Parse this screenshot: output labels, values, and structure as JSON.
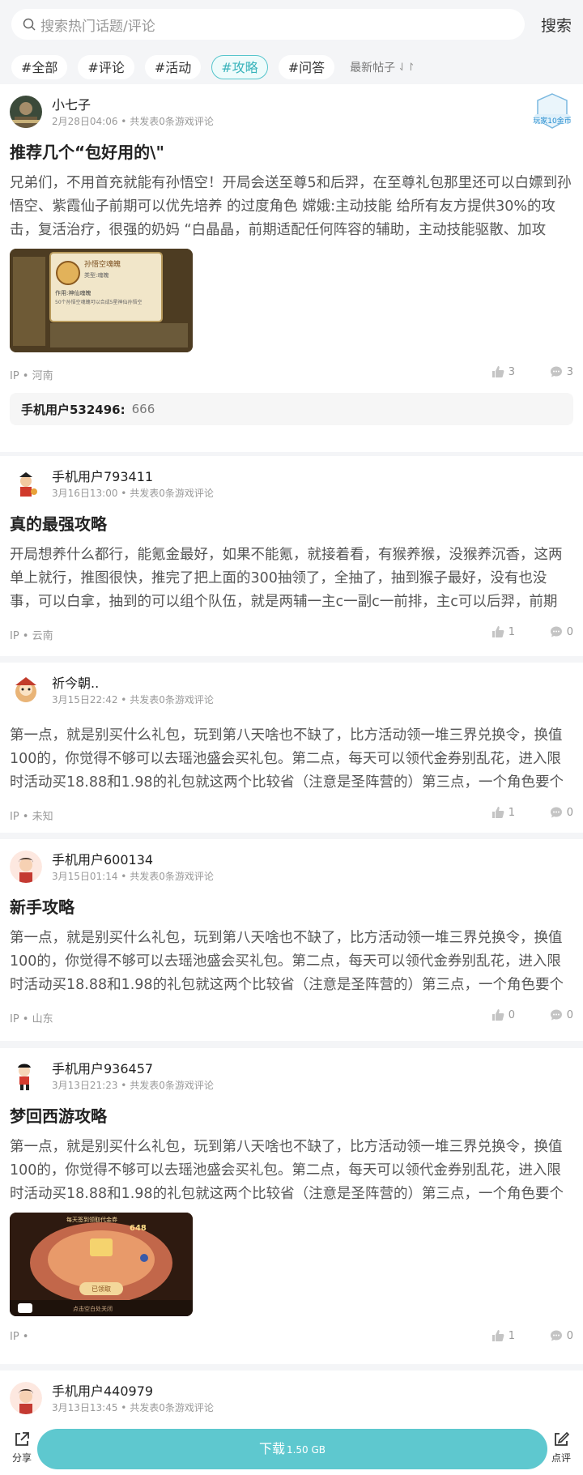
{
  "search": {
    "placeholder": "搜索热门话题/评论",
    "button": "搜索"
  },
  "tabs": [
    {
      "label": "#全部"
    },
    {
      "label": "#评论"
    },
    {
      "label": "#活动"
    },
    {
      "label": "#攻略"
    },
    {
      "label": "#问答"
    }
  ],
  "active_tab": "#攻略",
  "sort": {
    "label": "最新帖子",
    "icon": "sort-arrows-icon"
  },
  "posts": [
    {
      "user": "小七子",
      "meta": "2月28日04:06 • 共发表0条游戏评论",
      "badge": "玩家10金币",
      "title": "推荐几个“包好用的\\\"",
      "body": "兄弟们，不用首充就能有孙悟空！开局会送至尊5和后羿，在至尊礼包那里还可以白嫖到孙悟空、紫霞仙子前期可以优先培养 的过度角色 嫦娥:主动技能 给所有友方提供30%的攻击，复活治疗，很强的奶妈 “白晶晶，前期适配任何阵容的辅助，主动技能驱散、加攻",
      "ip": "IP • 河南",
      "likes": "3",
      "comments": "3",
      "reply_user": "手机用户532496:",
      "reply_text": "666"
    },
    {
      "user": "手机用户793411",
      "meta": "3月16日13:00 • 共发表0条游戏评论",
      "title": "真的最强攻略",
      "body": "开局想养什么都行，能氪金最好，如果不能氪，就接着看，有猴养猴，没猴养沉香，这两单上就行，推图很快，推完了把上面的300抽领了，全抽了，抽到猴子最好，没有也没事，可以白拿，抽到的可以组个队伍，就是两辅一主c一副c一前排，主c可以后羿，前期",
      "ip": "IP • 云南",
      "likes": "1",
      "comments": "0"
    },
    {
      "user": "祈今朝..",
      "meta": "3月15日22:42 • 共发表0条游戏评论",
      "title": "",
      "body": "第一点，就是别买什么礼包，玩到第八天啥也不缺了，比方活动领一堆三界兑换令，换值100的，你觉得不够可以去瑶池盛会买礼包。第二点，每天可以领代金券别乱花，进入限时活动买18.88和1.98的礼包就这两个比较省（注意是圣阵营的）第三点，一个角色要个",
      "ip": "IP • 未知",
      "likes": "1",
      "comments": "0"
    },
    {
      "user": "手机用户600134",
      "meta": "3月15日01:14 • 共发表0条游戏评论",
      "title": "新手攻略",
      "body": "第一点，就是别买什么礼包，玩到第八天啥也不缺了，比方活动领一堆三界兑换令，换值100的，你觉得不够可以去瑶池盛会买礼包。第二点，每天可以领代金券别乱花，进入限时活动买18.88和1.98的礼包就这两个比较省（注意是圣阵营的）第三点，一个角色要个",
      "ip": "IP • 山东",
      "likes": "0",
      "comments": "0"
    },
    {
      "user": "手机用户936457",
      "meta": "3月13日21:23 • 共发表0条游戏评论",
      "title": "梦回西游攻略",
      "body": "第一点，就是别买什么礼包，玩到第八天啥也不缺了，比方活动领一堆三界兑换令，换值100的，你觉得不够可以去瑶池盛会买礼包。第二点，每天可以领代金券别乱花，进入限时活动买18.88和1.98的礼包就这两个比较省（注意是圣阵营的）第三点，一个角色要个",
      "ip": "IP •",
      "likes": "1",
      "comments": "0"
    },
    {
      "user": "手机用户440979",
      "meta": "3月13日13:45 • 共发表0条游戏评论"
    }
  ],
  "thumb1": {
    "title": "孙悟空魂魄",
    "sub": "类型:魂魄",
    "label": "作用:神仙魂魄",
    "desc": "50个孙悟空魂魄可以合成5星神仙孙悟空"
  },
  "thumb2": {
    "top": "每天签到领取代金券",
    "num": "648",
    "btn": "已领取",
    "bottom": "点击空白处关闭"
  },
  "bottom": {
    "share": "分享",
    "download": "下载",
    "size": "1.50 GB",
    "review": "点评"
  },
  "colors": {
    "accent": "#5ec8cf",
    "active_tab": "#38b3bb"
  }
}
